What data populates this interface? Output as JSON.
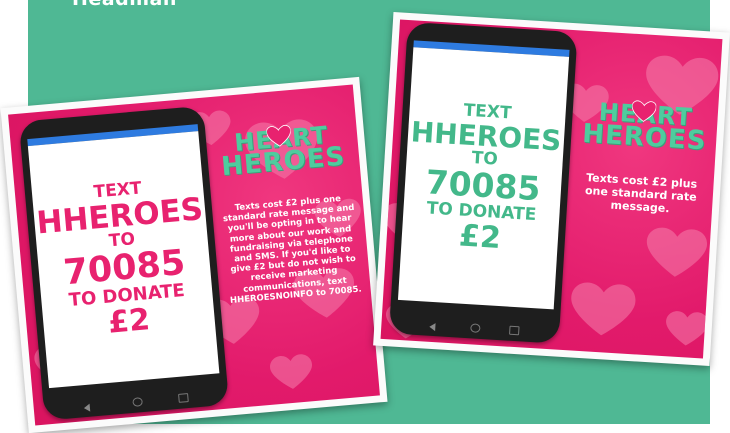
{
  "header": {
    "caption": "Headman"
  },
  "left_poster": {
    "screen_lines": [
      "TEXT",
      "HHEROES",
      "TO",
      "70085",
      "TO DONATE",
      "£2"
    ],
    "logo_line1": "HEART",
    "logo_line2": "HEROES",
    "disclaimer": "Texts cost £2 plus one standard rate message and you'll be opting in to hear more about our work and fundraising via telephone and SMS. If you'd like to give £2 but do not wish to receive marketing communications, text HHEROESNOINFO to 70085."
  },
  "right_poster": {
    "screen_lines": [
      "TEXT",
      "HHEROES",
      "TO",
      "70085",
      "TO DONATE",
      "£2"
    ],
    "logo_line1": "HEART",
    "logo_line2": "HEROES",
    "disclaimer": "Texts cost £2 plus one standard rate message."
  },
  "colors": {
    "teal_background": "#4fb894",
    "poster_pink": "#e21a6b",
    "screen_text_pink": "#e8226f",
    "screen_text_green": "#43b88a",
    "logo_green": "#4fcc9e",
    "phone_status_bar": "#2e7be0"
  },
  "icons": [
    "heart-icon",
    "back-nav-icon",
    "home-nav-icon",
    "recent-apps-nav-icon"
  ]
}
